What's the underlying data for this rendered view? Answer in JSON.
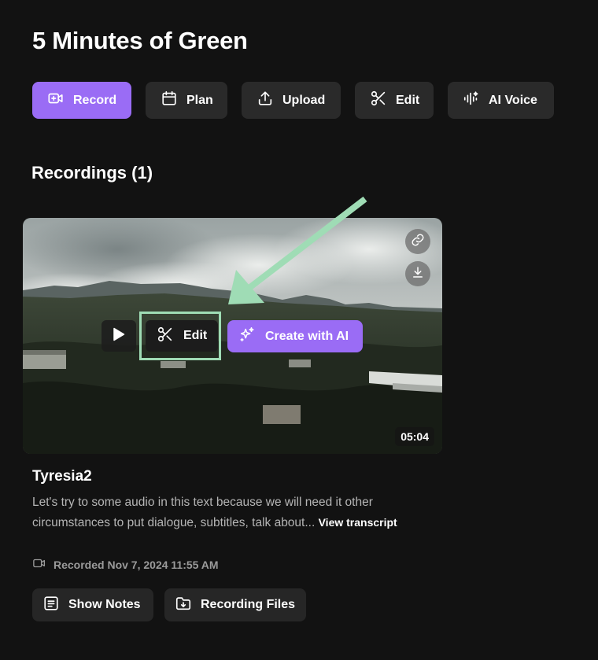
{
  "page": {
    "title": "5 Minutes of Green"
  },
  "toolbar": {
    "record_label": "Record",
    "plan_label": "Plan",
    "upload_label": "Upload",
    "edit_label": "Edit",
    "ai_voice_label": "AI Voice"
  },
  "recordings": {
    "heading": "Recordings (1)",
    "items": [
      {
        "title": "Tyresia2",
        "description": "Let's try to some audio in this text because we will need it other circumstances to put dialogue, subtitles, talk about...",
        "view_transcript_label": "View transcript",
        "recorded_text": "Recorded Nov 7, 2024 11:55 AM",
        "duration": "05:04",
        "edit_label": "Edit",
        "create_ai_label": "Create with AI",
        "show_notes_label": "Show Notes",
        "recording_files_label": "Recording Files"
      }
    ]
  },
  "colors": {
    "background": "#121212",
    "primary_accent": "#9a6cf5",
    "button_surface": "#2a2a2a",
    "highlight": "#9fdcb5"
  },
  "icons": {
    "record": "video-plus-icon",
    "plan": "calendar-icon",
    "upload": "upload-icon",
    "edit": "scissors-icon",
    "ai_voice": "ai-voice-icon",
    "link": "link-icon",
    "download": "download-icon",
    "play": "play-icon",
    "create_ai": "sparkles-icon",
    "recorded": "video-camera-icon",
    "notes": "notes-icon",
    "files": "folder-download-icon"
  }
}
